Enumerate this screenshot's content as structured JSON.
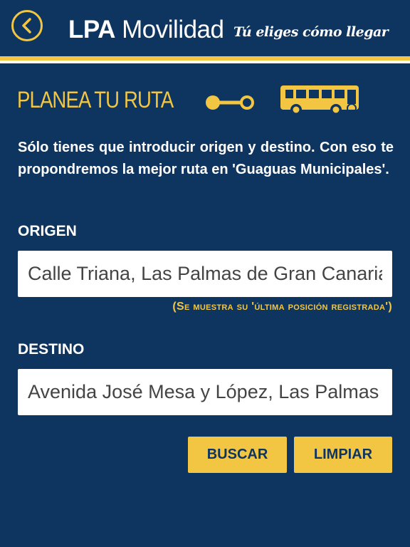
{
  "header": {
    "title_bold": "LPA",
    "title_light": "Movilidad",
    "tagline": "Tú eliges cómo llegar",
    "back_icon": "chevron-left-icon"
  },
  "section": {
    "title": "PLANEA TU RUTA",
    "route_icon": "route-icon",
    "bus_icon": "bus-icon"
  },
  "intro": "Sólo tienes que introducir origen y destino. Con eso te propondremos la mejor ruta en 'Guaguas Municipales'.",
  "origin": {
    "label": "ORIGEN",
    "value": "Calle Triana, Las Palmas de Gran Canaria",
    "hint": "(Se muestra su 'última posición registrada')"
  },
  "destination": {
    "label": "DESTINO",
    "value": "Avenida José Mesa y López, Las Palmas de Gran Canaria"
  },
  "buttons": {
    "search": "BUSCAR",
    "clear": "LIMPIAR"
  },
  "colors": {
    "background": "#0e3560",
    "accent": "#f2c643",
    "text": "#ffffff"
  }
}
